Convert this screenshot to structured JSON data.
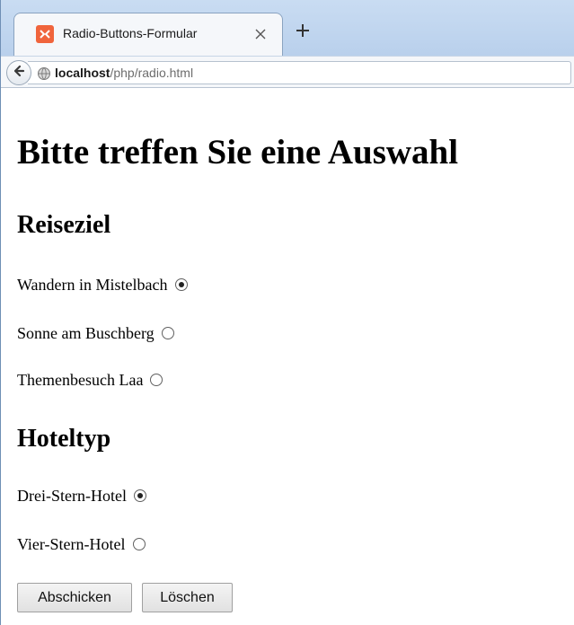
{
  "tab": {
    "title": "Radio-Buttons-Formular",
    "favicon": "xampp-icon",
    "close_icon": "close-icon",
    "new_tab_icon": "plus-icon"
  },
  "address_bar": {
    "host": "localhost",
    "path": "/php/radio.html"
  },
  "page": {
    "heading": "Bitte treffen Sie eine Auswahl",
    "groups": [
      {
        "title": "Reiseziel",
        "options": [
          {
            "label": "Wandern in Mistelbach",
            "checked": true
          },
          {
            "label": "Sonne am Buschberg",
            "checked": false
          },
          {
            "label": "Themenbesuch Laa",
            "checked": false
          }
        ]
      },
      {
        "title": "Hoteltyp",
        "options": [
          {
            "label": "Drei-Stern-Hotel",
            "checked": true
          },
          {
            "label": "Vier-Stern-Hotel",
            "checked": false
          }
        ]
      }
    ],
    "submit_label": "Abschicken",
    "reset_label": "Löschen"
  },
  "colors": {
    "tabstrip": "#c9dcf2",
    "favicon": "#f0643c"
  }
}
